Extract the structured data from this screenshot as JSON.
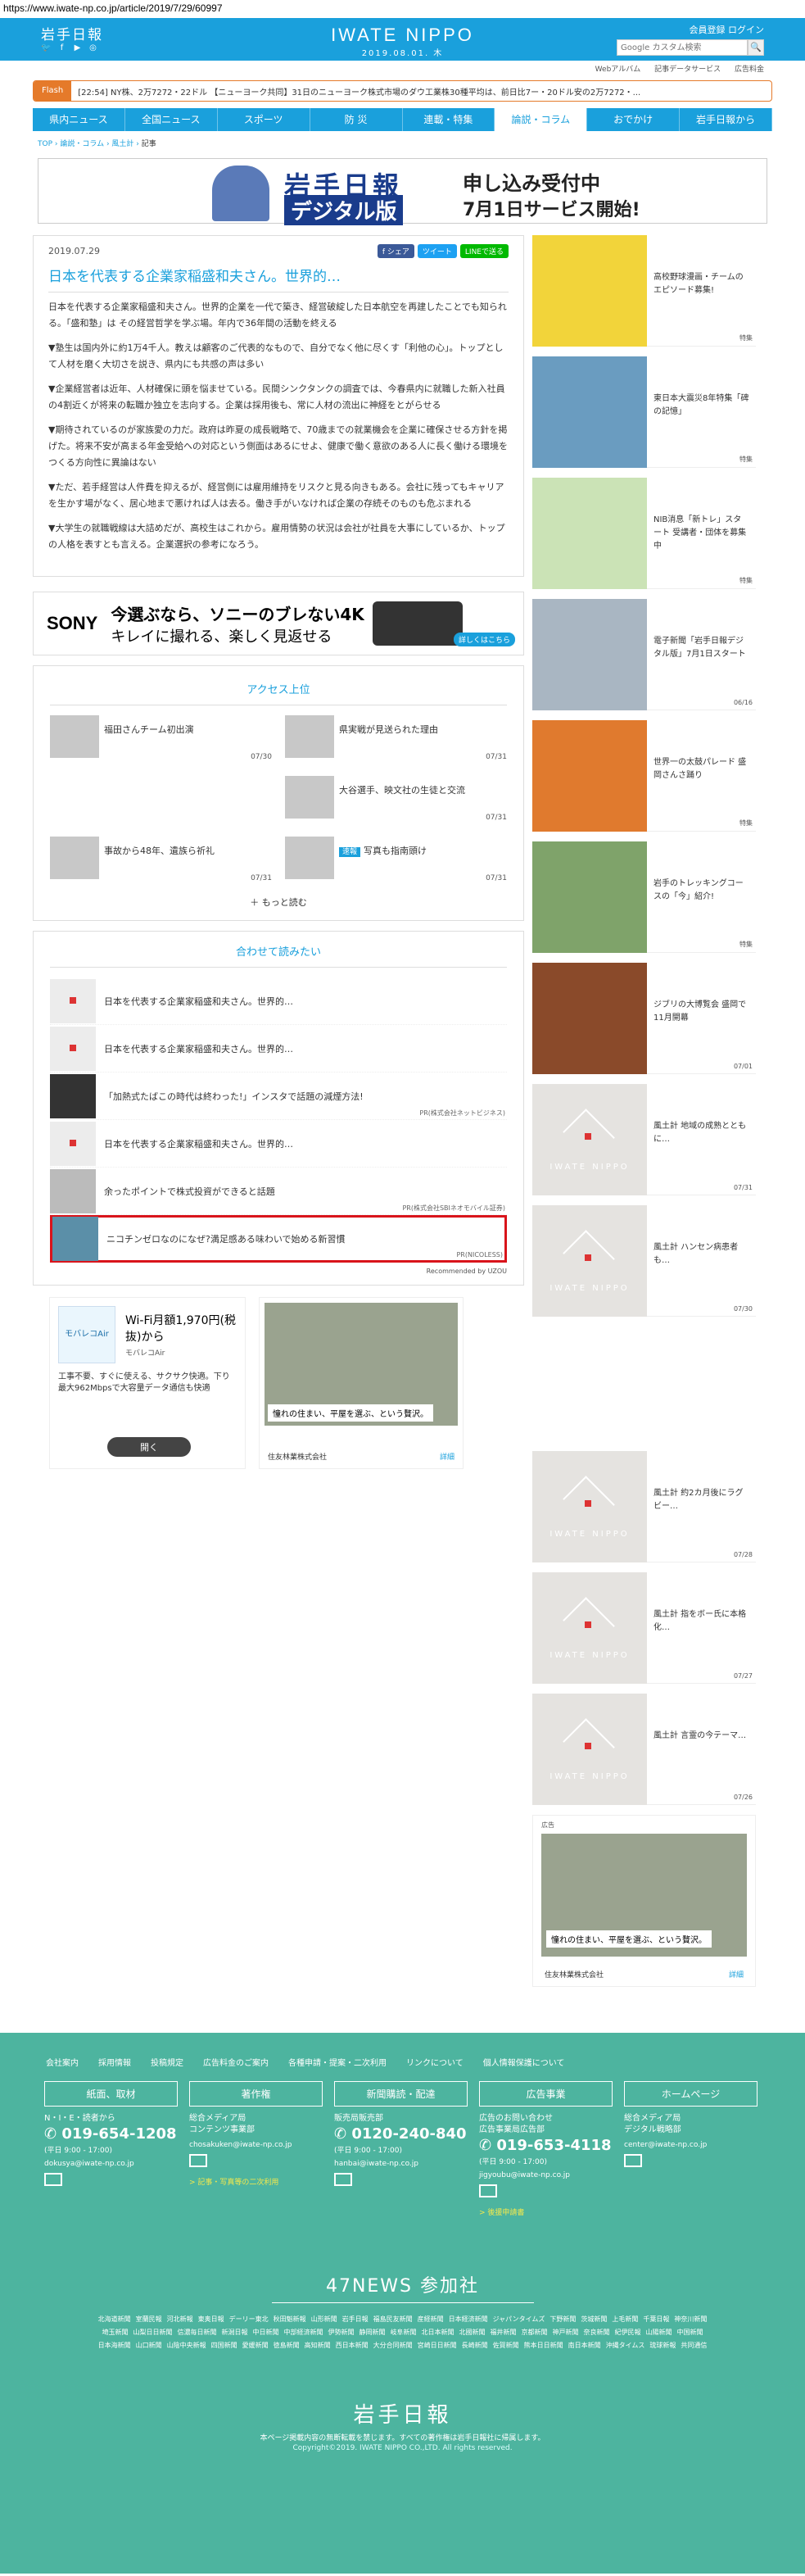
{
  "url": "https://www.iwate-np.co.jp/article/2019/7/29/60997",
  "header": {
    "logo": "岩手日報",
    "site_name": "IWATE NIPPO",
    "date": "2019.08.01. 木",
    "login": "会員登録 ログイン",
    "search_placeholder": "Google カスタム検索",
    "search_btn": "🔍"
  },
  "subnav": [
    "Webアルバム",
    "記事データサービス",
    "広告料金"
  ],
  "flash": {
    "tag": "Flash",
    "text": "[22:54] NY株、2万7272・22ドル 【ニューヨーク共同】31日のニューヨーク株式市場のダウ工業株30種平均は、前日比7ー・20ドル安の2万7272・..."
  },
  "gnav": [
    "県内ニュース",
    "全国ニュース",
    "スポーツ",
    "防 災",
    "連載・特集",
    "論説・コラム",
    "おでかけ",
    "岩手日報から"
  ],
  "gnav_active": 5,
  "breadcrumb": [
    "TOP",
    "論説・コラム",
    "風土計",
    "記事"
  ],
  "banner": {
    "logo_text": "岩手日報",
    "logo_sub": "デジタル版",
    "headline": "申し込み受付中",
    "subline": "7月1日サービス開始!"
  },
  "article": {
    "date": "2019.07.29",
    "share_fb": "f シェア",
    "share_tw": "ツイート",
    "share_line": "LINEで送る",
    "title": "日本を代表する企業家稲盛和夫さん。世界的…",
    "paragraphs": [
      "日本を代表する企業家稲盛和夫さん。世界的企業を一代で築き、経営破綻した日本航空を再建したことでも知られる。「盛和塾」は その経営哲学を学ぶ場。年内で36年間の活動を終える",
      "▼塾生は国内外に約1万4千人。教えは顧客のご代表的なもので、自分でなく他に尽くす「利他の心」。トップとして人材を磨く大切さを説き、県内にも共感の声は多い",
      "▼企業経営者は近年、人材確保に頭を悩ませている。民間シンクタンクの調査では、今春県内に就職した新入社員の4割近くが将来の転職か独立を志向する。企業は採用後も、常に人材の流出に神経をとがらせる",
      "▼期待されているのが家族愛の力だ。政府は昨夏の成長戦略で、70歳までの就業機会を企業に確保させる方針を掲げた。将来不安が高まる年金受給への対応という側面はあるにせよ、健康で働く意欲のある人に長く働ける環境をつくる方向性に異論はない",
      "▼ただ、若手経営は人件費を抑えるが、経営側には雇用維持をリスクと見る向きもある。会社に残ってもキャリアを生かす場がなく、居心地まで悪ければ人は去る。働き手がいなければ企業の存続そのものも危ぶまれる",
      "▼大学生の就職戦線は大詰めだが、高校生はこれから。雇用情勢の状況は会社が社員を大事にしているか、トップの人格を表すとも言える。企業選択の参考になろう。"
    ]
  },
  "ad_sony": {
    "brand": "SONY",
    "line1": "今選ぶなら、ソニーのブレない4K",
    "line2": "キレイに撮れる、楽しく見返せる",
    "more": "詳しくはこちら"
  },
  "ranking": {
    "title": "アクセス上位",
    "items": [
      {
        "title": "福田さんチーム初出演",
        "date": "07/30"
      },
      {
        "title": "県実戦が見送られた理由",
        "date": "07/31"
      },
      {
        "title": "",
        "date": ""
      },
      {
        "title": "大谷選手、映文社の生徒と交流",
        "date": "07/31"
      },
      {
        "title": "事故から48年、遺族ら祈礼",
        "date": "07/31"
      },
      {
        "badge": "速報",
        "title": "写真も指南頭け",
        "date": "07/31"
      }
    ],
    "more": "＋ もっと読む"
  },
  "recommend": {
    "title": "合わせて読みたい",
    "items": [
      {
        "title": "日本を代表する企業家稲盛和夫さん。世界的…",
        "sponsor": ""
      },
      {
        "title": "日本を代表する企業家稲盛和夫さん。世界的…",
        "sponsor": ""
      },
      {
        "title": "「加熱式たばこの時代は終わった!」インスタで話題の減煙方法!",
        "sponsor": "PR(株式会社ネットビジネス)"
      },
      {
        "title": "日本を代表する企業家稲盛和夫さん。世界的…",
        "sponsor": ""
      },
      {
        "title": "余ったポイントで株式投資ができると話題",
        "sponsor": "PR(株式会社SBIネオモバイル証券)"
      },
      {
        "title": "ニコチンゼロなのになぜ?満足感ある味わいで始める新習慣",
        "sponsor": "PR(NICOLESS)"
      }
    ],
    "by": "Recommended by UZOU"
  },
  "ad_wifi": {
    "logo": "モバレコAir",
    "headline": "Wi-Fi月額1,970円(税抜)から",
    "sub": "モバレコAir",
    "desc": "工事不要、すぐに使える、サクサク快適。下り最大962Mbpsで大容量データ通信も快適",
    "btn": "開く"
  },
  "ad_house": {
    "caption": "憧れの住まい、平屋を選ぶ、という贅沢。",
    "company": "住友林業株式会社",
    "detail": "詳細"
  },
  "sidebar": [
    {
      "title": "高校野球漫画・チームのエピソード募集!",
      "date": "特集"
    },
    {
      "title": "東日本大震災8年特集「碑の記憶」",
      "date": "特集"
    },
    {
      "title": "NIB消息「新トレ」スタート 受講者・団体を募集中",
      "date": "特集"
    },
    {
      "title": "電子新聞「岩手日報デジタル版」7月1日スタート",
      "date": "06/16"
    },
    {
      "title": "世界一の太鼓パレード 盛岡さんさ踊り",
      "date": "特集"
    },
    {
      "title": "岩手のトレッキングコースの「今」紹介!",
      "date": "特集"
    },
    {
      "title": "ジブリの大博覧会 盛岡で11月開幕",
      "date": "07/01"
    },
    {
      "title": "風土計 地域の成熟とともに…",
      "date": "07/31"
    },
    {
      "title": "風土計 ハンセン病患者も…",
      "date": "07/30"
    },
    {
      "title": "風土計 約2カ月後にラグビー…",
      "date": "07/28"
    },
    {
      "title": "風土計 指をボー氏に本格化…",
      "date": "07/27"
    },
    {
      "title": "風土計 言霊の今テーマ…",
      "date": "07/26"
    }
  ],
  "side_ad": {
    "label": "広告",
    "caption": "憧れの住まい、平屋を選ぶ、という贅沢。",
    "company": "住友林業株式会社",
    "detail": "詳細"
  },
  "footer": {
    "links": [
      "会社案内",
      "採用情報",
      "投稿規定",
      "広告料金のご案内",
      "各種申請・提案・二次利用",
      "リンクについて",
      "個人情報保護について"
    ],
    "cols": [
      {
        "head": "紙面、取材",
        "lines": [
          "N・I・E・読者から"
        ],
        "tel": "019-654-1208",
        "hours": "(平日 9:00 - 17:00)",
        "mail": "dokusya@iwate-np.co.jp",
        "link": ""
      },
      {
        "head": "著作権",
        "lines": [
          "総合メディア局",
          "コンテンツ事業部"
        ],
        "tel": "",
        "hours": "",
        "mail": "chosakuken@iwate-np.co.jp",
        "link": "> 記事・写真等の二次利用"
      },
      {
        "head": "新聞購読・配達",
        "lines": [
          "販売局販売部"
        ],
        "tel": "0120-240-840",
        "hours": "(平日 9:00 - 17:00)",
        "mail": "hanbai@iwate-np.co.jp",
        "link": ""
      },
      {
        "head": "広告事業",
        "lines": [
          "広告のお問い合わせ",
          "広告事業局広告部"
        ],
        "tel": "019-653-4118",
        "hours": "(平日 9:00 - 17:00)",
        "mail": "jigyoubu@iwate-np.co.jp",
        "link": "> 後援申請書"
      },
      {
        "head": "ホームページ",
        "lines": [
          "総合メディア局",
          "デジタル戦略部"
        ],
        "tel": "",
        "hours": "",
        "mail": "center@iwate-np.co.jp",
        "link": ""
      }
    ],
    "news47": "47NEWS 参加社",
    "papers": [
      "北海道新聞",
      "室蘭民報",
      "河北新報",
      "東奥日報",
      "デーリー東北",
      "秋田魁新報",
      "山形新聞",
      "岩手日報",
      "福島民友新聞",
      "産経新聞",
      "日本経済新聞",
      "ジャパンタイムズ",
      "下野新聞",
      "茨城新聞",
      "上毛新聞",
      "千葉日報",
      "神奈川新聞",
      "埼玉新聞",
      "山梨日日新聞",
      "信濃毎日新聞",
      "新潟日報",
      "中日新聞",
      "中部経済新聞",
      "伊勢新聞",
      "静岡新聞",
      "岐阜新聞",
      "北日本新聞",
      "北國新聞",
      "福井新聞",
      "京都新聞",
      "神戸新聞",
      "奈良新聞",
      "紀伊民報",
      "山陽新聞",
      "中国新聞",
      "日本海新聞",
      "山口新聞",
      "山陰中央新報",
      "四国新聞",
      "愛媛新聞",
      "徳島新聞",
      "高知新聞",
      "西日本新聞",
      "大分合同新聞",
      "宮崎日日新聞",
      "長崎新聞",
      "佐賀新聞",
      "熊本日日新聞",
      "南日本新聞",
      "沖縄タイムス",
      "琉球新報",
      "共同通信"
    ],
    "logo": "岩手日報",
    "note": "本ページ掲載内容の無断転載を禁じます。すべての著作権は岩手日報社に帰属します。",
    "copy": "Copyright©2019. IWATE NIPPO CO.,LTD. All rights reserved."
  }
}
